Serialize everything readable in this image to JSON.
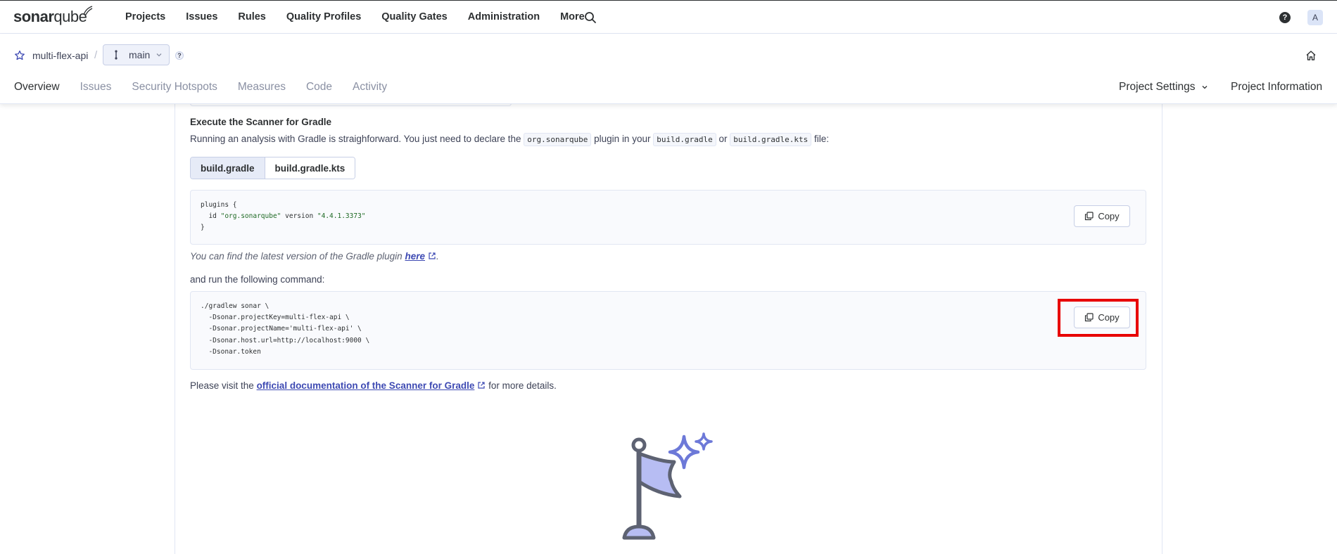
{
  "topbar": {
    "logo_bold": "sonar",
    "logo_light": "qube",
    "nav": [
      "Projects",
      "Issues",
      "Rules",
      "Quality Profiles",
      "Quality Gates",
      "Administration",
      "More"
    ],
    "avatar_letter": "A",
    "help_label": "?"
  },
  "project": {
    "name": "multi-flex-api",
    "separator": "/",
    "branch": "main",
    "help_label": "?",
    "tabs": [
      "Overview",
      "Issues",
      "Security Hotspots",
      "Measures",
      "Code",
      "Activity"
    ],
    "active_tab": "Overview",
    "settings_label": "Project Settings",
    "info_label": "Project Information"
  },
  "content": {
    "heading": "Execute the Scanner for Gradle",
    "intro_pre": "Running an analysis with Gradle is straighforward. You just need to declare the",
    "intro_code1": "org.sonarqube",
    "intro_mid": "plugin in your",
    "intro_code2": "build.gradle",
    "intro_or": "or",
    "intro_code3": "build.gradle.kts",
    "intro_post": "file:",
    "build_tabs": [
      "build.gradle",
      "build.gradle.kts"
    ],
    "selected_build_tab": "build.gradle",
    "plugin_code": {
      "line1": "plugins {",
      "line2_pre": "  id ",
      "line2_id": "\"org.sonarqube\"",
      "line2_mid": " version ",
      "line2_ver": "\"4.4.1.3373\"",
      "line3": "}"
    },
    "version_note_pre": "You can find the latest version of the Gradle plugin",
    "version_note_link": "here",
    "version_note_post": ".",
    "run_label": "and run the following command:",
    "command_lines": [
      "./gradlew sonar \\",
      "  -Dsonar.projectKey=multi-flex-api \\",
      "  -Dsonar.projectName='multi-flex-api' \\",
      "  -Dsonar.host.url=http://localhost:9000 \\",
      "  -Dsonar.token"
    ],
    "copy_label": "Copy",
    "docs_pre": "Please visit the",
    "docs_link": "official documentation of the Scanner for Gradle",
    "docs_post": "for more details."
  },
  "colors": {
    "highlight": "#e80000",
    "link": "#3e4ab3",
    "flag_accent": "#6d79d8"
  }
}
